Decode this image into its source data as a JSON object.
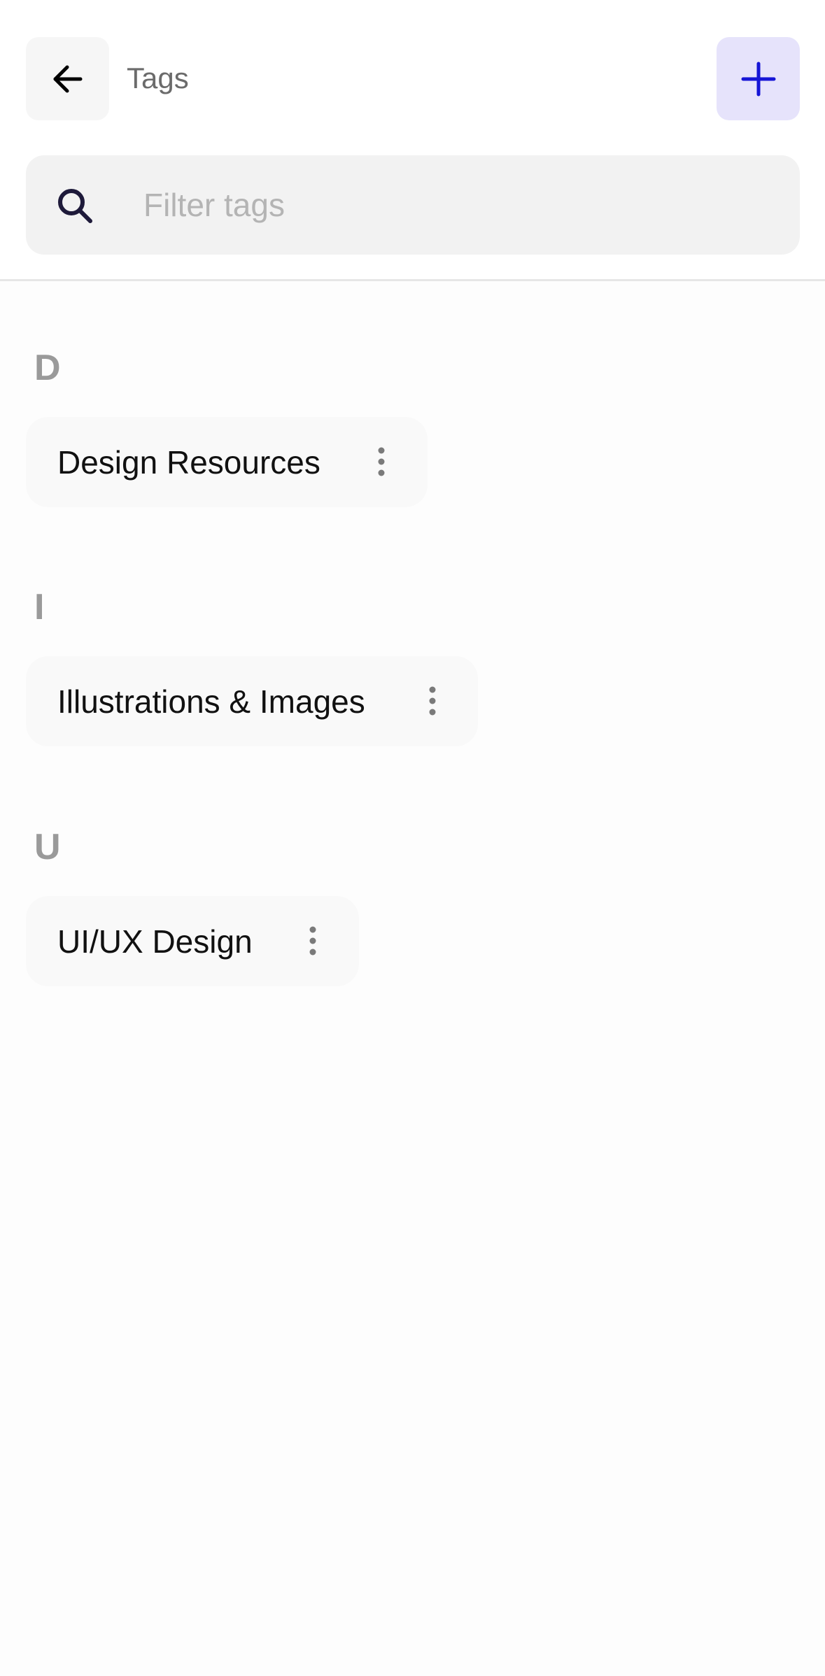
{
  "header": {
    "title": "Tags",
    "back_icon": "arrow-left-icon",
    "add_icon": "plus-icon"
  },
  "search": {
    "placeholder": "Filter tags",
    "value": "",
    "icon": "search-icon"
  },
  "sections": [
    {
      "letter": "D",
      "tags": [
        {
          "label": "Design Resources",
          "menu_icon": "more-vertical-icon"
        }
      ]
    },
    {
      "letter": "I",
      "tags": [
        {
          "label": "Illustrations & Images",
          "menu_icon": "more-vertical-icon"
        }
      ]
    },
    {
      "letter": "U",
      "tags": [
        {
          "label": "UI/UX Design",
          "menu_icon": "more-vertical-icon"
        }
      ]
    }
  ],
  "colors": {
    "accent": "#1515d6",
    "accent_bg": "#e6e3fb",
    "section_letter": "#9a9a9a",
    "placeholder": "#b4b4b4",
    "search_icon": "#1e1a3a"
  }
}
